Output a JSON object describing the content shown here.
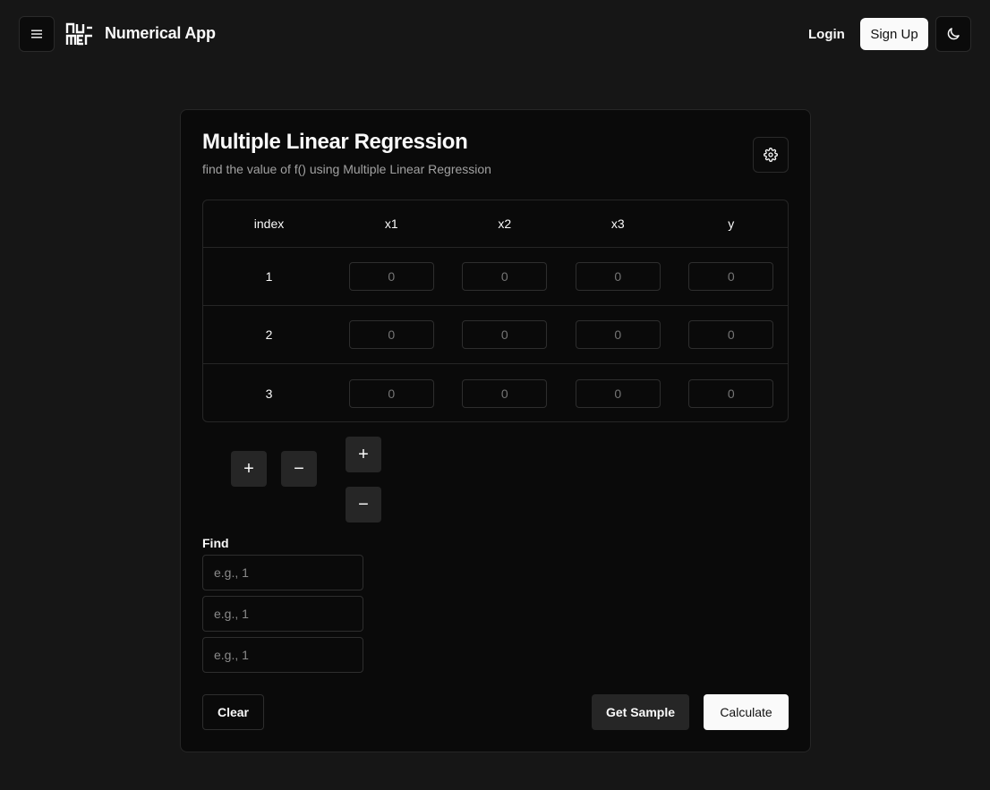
{
  "header": {
    "menu_icon": "hamburger-menu-icon",
    "logo_icon": "numer-logo-icon",
    "app_title": "Numerical App",
    "login_label": "Login",
    "signup_label": "Sign Up",
    "theme_icon": "moon-icon"
  },
  "card": {
    "title": "Multiple Linear Regression",
    "description": "find the value of f() using Multiple Linear Regression",
    "settings_icon": "gear-icon",
    "table": {
      "columns": [
        "index",
        "x1",
        "x2",
        "x3",
        "y"
      ],
      "rows": [
        {
          "index": "1",
          "values": [
            "0",
            "0",
            "0",
            "0"
          ]
        },
        {
          "index": "2",
          "values": [
            "0",
            "0",
            "0",
            "0"
          ]
        },
        {
          "index": "3",
          "values": [
            "0",
            "0",
            "0",
            "0"
          ]
        }
      ],
      "cell_placeholder": "0"
    },
    "controls": {
      "add_row_label": "+",
      "remove_row_label": "−",
      "add_col_label": "+",
      "remove_col_label": "−"
    },
    "find": {
      "label": "Find",
      "placeholders": [
        "e.g., 1",
        "e.g., 1",
        "e.g., 1"
      ]
    },
    "clear_label": "Clear",
    "sample_label": "Get Sample",
    "calculate_label": "Calculate"
  },
  "colors": {
    "background": "#161616",
    "card": "#0a0a0a",
    "border": "#262626",
    "primary_button": "#fafafa",
    "secondary_button": "#262626"
  }
}
